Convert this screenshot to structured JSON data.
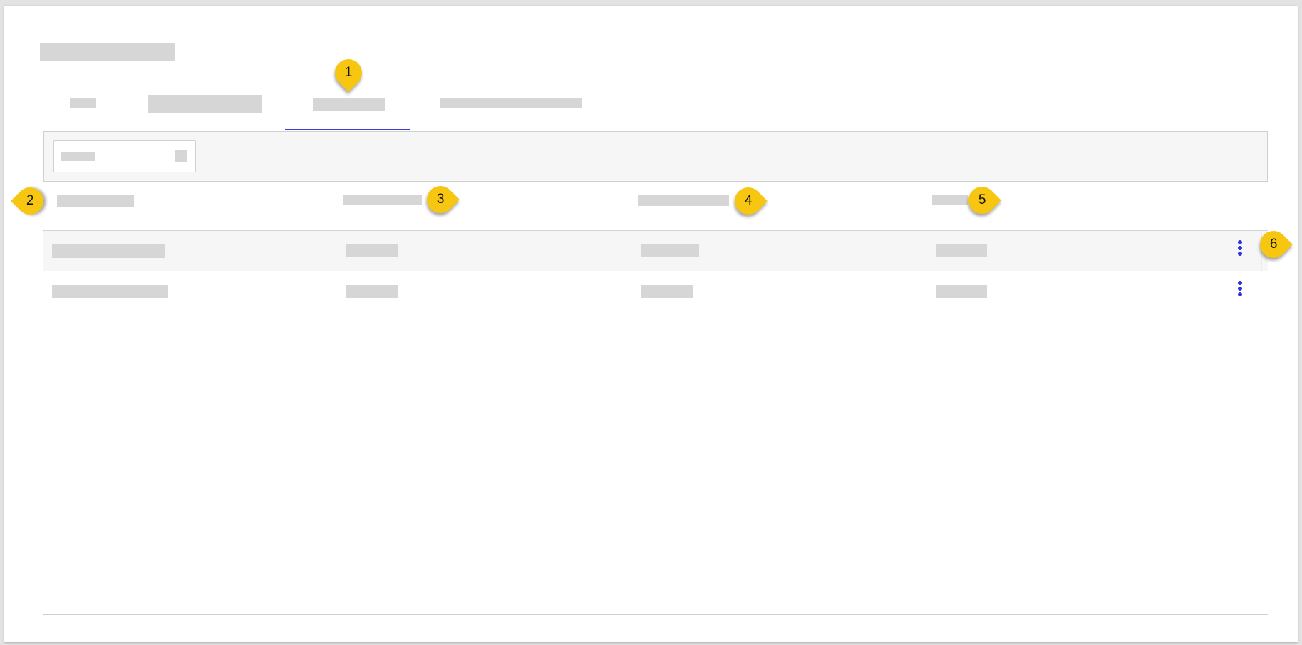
{
  "callouts": [
    "1",
    "2",
    "3",
    "4",
    "5",
    "6"
  ],
  "accent_color": "#3b3bd9",
  "callout_color": "#f7c611",
  "icons": {
    "row_menu": "more-vertical-icon"
  }
}
